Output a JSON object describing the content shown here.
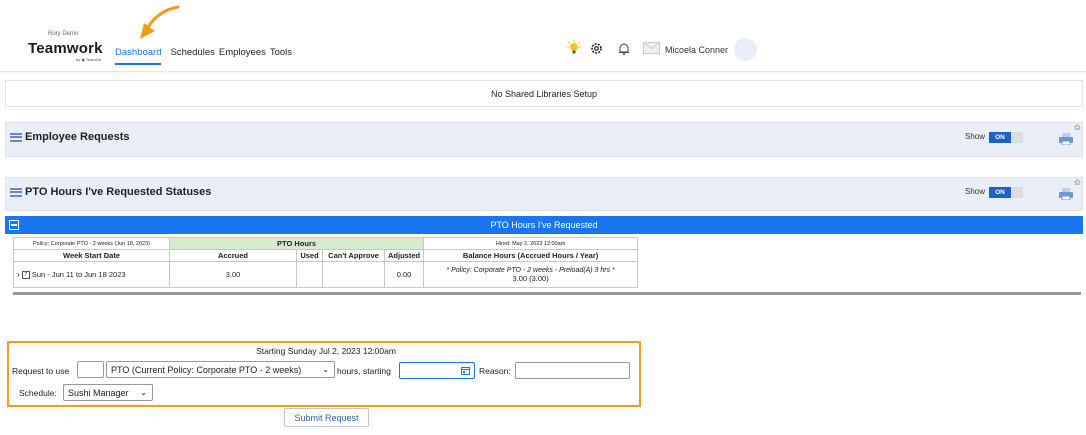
{
  "header": {
    "brand_small": "Rory Demo",
    "brand": "Teamwork",
    "brand_sub": "by ◉ TeamOn",
    "nav": [
      "Dashboard",
      "Schedules",
      "Employees",
      "Tools"
    ],
    "user_name": "Micoela Conner",
    "icons": [
      "lightbulb-icon",
      "gear-icon",
      "bell-icon",
      "mail-icon"
    ]
  },
  "notice": "No Shared Libraries Setup",
  "sections": [
    {
      "title": "Employee Requests",
      "show_label": "Show",
      "toggle": "ON"
    },
    {
      "title": "PTO Hours I've Requested Statuses",
      "show_label": "Show",
      "toggle": "ON"
    }
  ],
  "bluebar": {
    "title": "PTO Hours I've Requested"
  },
  "table": {
    "policy": "Policy: Corporate PTO - 2 weeks (Jun 18, 2023)",
    "pto_hours": "PTO Hours",
    "hired": "Hired: May 2, 2023 12:00am",
    "cols": [
      "Week Start Date",
      "Accrued",
      "Used",
      "Can't Approve",
      "Adjusted",
      "Balance Hours (Accrued Hours / Year)"
    ],
    "row": {
      "week": "Sun - Jun 11 to Jun 18 2023",
      "accrued": "3.00",
      "used": "",
      "cant_approve": "",
      "adjusted": "0.00",
      "balance_note": "* Policy: Corporate PTO - 2 weeks - Preload(A) 3 hrs *",
      "balance": "3.00 (3.00)"
    }
  },
  "form": {
    "starting": "Starting Sunday Jul 2, 2023 12:00am",
    "request_label": "Request to use",
    "hours_value": "",
    "pto_select": "PTO (Current Policy: Corporate PTO - 2 weeks)",
    "hours_starting_label": "hours, starting",
    "date_value": "",
    "reason_label": "Reason:",
    "reason_value": "",
    "schedule_label": "Schedule:",
    "schedule_select": "Sushi Manager",
    "submit": "Submit Request"
  },
  "colors": {
    "accent": "#1976f1",
    "highlight": "#f49b1b",
    "green": "#d7eccf"
  }
}
